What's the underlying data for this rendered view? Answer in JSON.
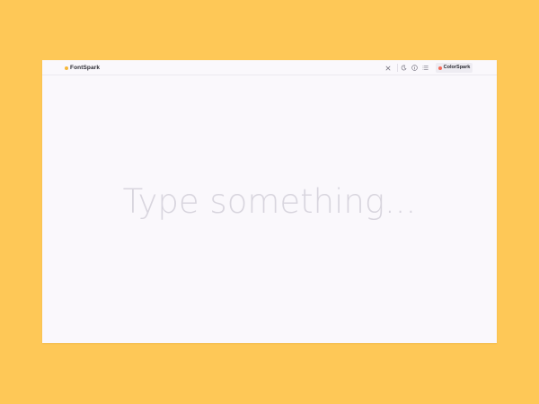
{
  "header": {
    "brand": "FontSpark",
    "brand_color": "#F6B739",
    "actions": {
      "close_icon": "close-icon",
      "theme_icon": "moon-icon",
      "info_icon": "info-icon",
      "list_icon": "list-icon"
    },
    "colorspark_label": "ColorSpark",
    "colorspark_color": "#F36A5A"
  },
  "main": {
    "input_value": "",
    "placeholder": "Type something..."
  },
  "colors": {
    "page_background": "#FEC857",
    "window_background": "#FAF8FC",
    "placeholder_text": "#D8D5DE"
  }
}
